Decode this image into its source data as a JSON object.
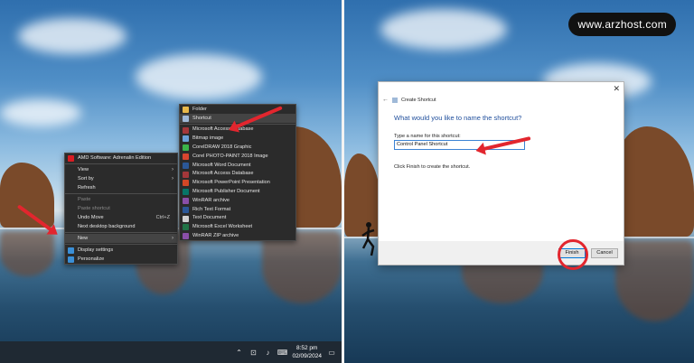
{
  "watermark": "www.arzhost.com",
  "context_menu": {
    "items": [
      {
        "label": "AMD Software: Adrenalin Edition",
        "icon": "amd-icon",
        "type": "item"
      },
      {
        "type": "sep"
      },
      {
        "label": "View",
        "type": "item",
        "submenu": true
      },
      {
        "label": "Sort by",
        "type": "item",
        "submenu": true
      },
      {
        "label": "Refresh",
        "type": "item"
      },
      {
        "type": "sep"
      },
      {
        "label": "Paste",
        "type": "disabled"
      },
      {
        "label": "Paste shortcut",
        "type": "disabled"
      },
      {
        "label": "Undo Move",
        "type": "item",
        "shortcut": "Ctrl+Z"
      },
      {
        "label": "Next desktop background",
        "type": "item"
      },
      {
        "type": "sep"
      },
      {
        "label": "New",
        "type": "item",
        "submenu": true,
        "highlight": true
      },
      {
        "type": "sep"
      },
      {
        "label": "Display settings",
        "icon": "display-icon",
        "type": "item"
      },
      {
        "label": "Personalize",
        "icon": "personalize-icon",
        "type": "item"
      }
    ]
  },
  "new_submenu": {
    "items": [
      {
        "label": "Folder",
        "icon": "folder-icon",
        "color": "#e8b84a"
      },
      {
        "label": "Shortcut",
        "icon": "shortcut-icon",
        "color": "#9fb9d8",
        "highlight": true
      },
      {
        "sep": true
      },
      {
        "label": "Microsoft Access Database",
        "icon": "access-icon",
        "color": "#a4373a"
      },
      {
        "label": "Bitmap image",
        "icon": "bitmap-icon",
        "color": "#6aa0d8"
      },
      {
        "label": "CorelDRAW 2018 Graphic",
        "icon": "coreldraw-icon",
        "color": "#3bb34a"
      },
      {
        "label": "Corel PHOTO-PAINT 2018 Image",
        "icon": "photopaint-icon",
        "color": "#d8452f"
      },
      {
        "label": "Microsoft Word Document",
        "icon": "word-icon",
        "color": "#2b5797"
      },
      {
        "label": "Microsoft Access Database",
        "icon": "access-icon",
        "color": "#a4373a"
      },
      {
        "label": "Microsoft PowerPoint Presentation",
        "icon": "powerpoint-icon",
        "color": "#d24726"
      },
      {
        "label": "Microsoft Publisher Document",
        "icon": "publisher-icon",
        "color": "#077568"
      },
      {
        "label": "WinRAR archive",
        "icon": "winrar-icon",
        "color": "#8a4fa8"
      },
      {
        "label": "Rich Text Format",
        "icon": "rtf-icon",
        "color": "#2b5797"
      },
      {
        "label": "Text Document",
        "icon": "text-icon",
        "color": "#d0d0d0"
      },
      {
        "label": "Microsoft Excel Worksheet",
        "icon": "excel-icon",
        "color": "#217346"
      },
      {
        "label": "WinRAR ZIP archive",
        "icon": "winrar-zip-icon",
        "color": "#8a4fa8"
      }
    ]
  },
  "taskbar": {
    "time": "8:52 pm",
    "date": "02/09/2024"
  },
  "dialog": {
    "title": "Create Shortcut",
    "question": "What would you like to name the shortcut?",
    "label": "Type a name for this shortcut:",
    "value": "Control Panel Shortcut",
    "hint": "Click Finish to create the shortcut.",
    "finish": "Finish",
    "cancel": "Cancel"
  },
  "colors": {
    "accent": "#e2262e",
    "menu_bg": "#2b2b2b",
    "taskbar": "#1f2933",
    "dialog_blue": "#1f4e9c"
  }
}
